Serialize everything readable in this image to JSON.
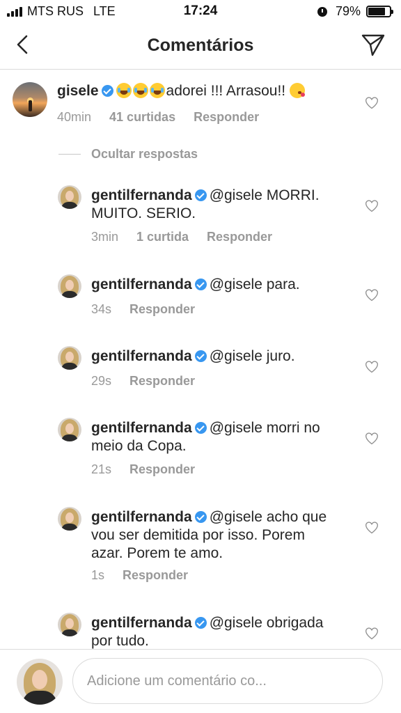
{
  "status_bar": {
    "carrier": "MTS RUS",
    "network": "LTE",
    "time": "17:24",
    "battery": "79%",
    "battery_level": 0.79
  },
  "header": {
    "title": "Comentários"
  },
  "comments": [
    {
      "user": "gisele",
      "text": "adorei !!! Arrasou!!",
      "time": "40min",
      "likes": "41 curtidas",
      "reply_label": "Responder"
    }
  ],
  "hide_replies_label": "Ocultar respostas",
  "replies": [
    {
      "user": "gentilfernanda",
      "mention": "@gisele",
      "line1": "MORRI.",
      "line2": "MUITO. SERIO.",
      "line3": "",
      "time": "3min",
      "likes": "1 curtida",
      "reply_label": "Responder"
    },
    {
      "user": "gentilfernanda",
      "mention": "@gisele",
      "line1": "para.",
      "line2": "",
      "line3": "",
      "time": "34s",
      "likes": "",
      "reply_label": "Responder"
    },
    {
      "user": "gentilfernanda",
      "mention": "@gisele",
      "line1": "juro.",
      "line2": "",
      "line3": "",
      "time": "29s",
      "likes": "",
      "reply_label": "Responder"
    },
    {
      "user": "gentilfernanda",
      "mention": "@gisele",
      "line1": "morri no",
      "line2": "meio da Copa.",
      "line3": "",
      "time": "21s",
      "likes": "",
      "reply_label": "Responder"
    },
    {
      "user": "gentilfernanda",
      "mention": "@gisele",
      "line1": "acho que",
      "line2": "vou ser demitida por isso. Porem",
      "line3": "azar. Porem te amo.",
      "time": "1s",
      "likes": "",
      "reply_label": "Responder"
    },
    {
      "user": "gentilfernanda",
      "mention": "@gisele",
      "line1": "obrigada",
      "line2": "por tudo.",
      "line3": "",
      "time": "",
      "likes": "",
      "reply_label": ""
    }
  ],
  "composer": {
    "placeholder": "Adicione um comentário co..."
  },
  "colors": {
    "text": "#262626",
    "meta": "#999999",
    "verified": "#3897f0",
    "divider": "#dbdbdb"
  },
  "icons": [
    "back-chevron-icon",
    "direct-send-icon",
    "verified-badge-icon",
    "heart-outline-icon"
  ]
}
